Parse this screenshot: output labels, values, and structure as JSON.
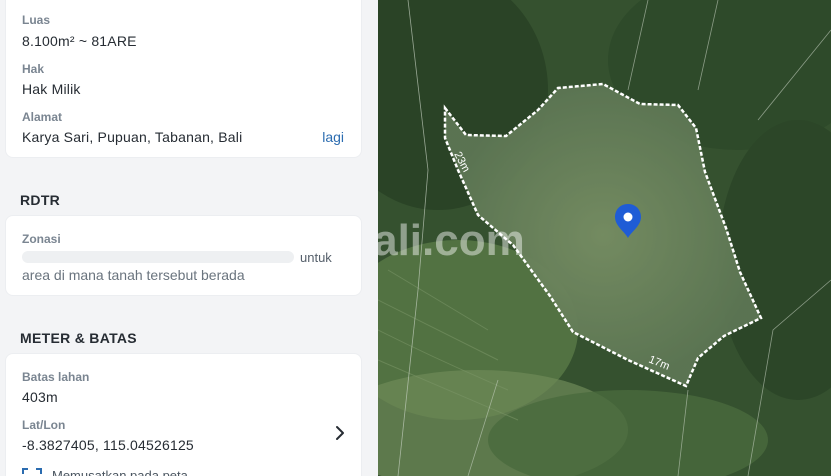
{
  "property": {
    "luas_label": "Luas",
    "luas_value": "8.100m² ~ 81ARE",
    "hak_label": "Hak",
    "hak_value": "Hak Milik",
    "alamat_label": "Alamat",
    "alamat_value": "Karya Sari, Pupuan, Tabanan, Bali",
    "alamat_more": "lagi"
  },
  "rdtr": {
    "title": "RDTR",
    "zonasi_label": "Zonasi",
    "zonasi_partial": "untuk",
    "zonasi_text": "area di mana tanah tersebut berada"
  },
  "meter": {
    "title": "METER & BATAS",
    "batas_label": "Batas lahan",
    "batas_value": "403m",
    "latlon_label": "Lat/Lon",
    "latlon_value": "-8.3827405, 115.04526125",
    "center_action": "Memusatkan pada peta"
  },
  "map": {
    "watermark": "dapbali.com",
    "edge_label_1": "23m",
    "edge_label_2": "17m",
    "marker_color": "#1f5cd6",
    "parcel_stroke": "#ffffff"
  }
}
